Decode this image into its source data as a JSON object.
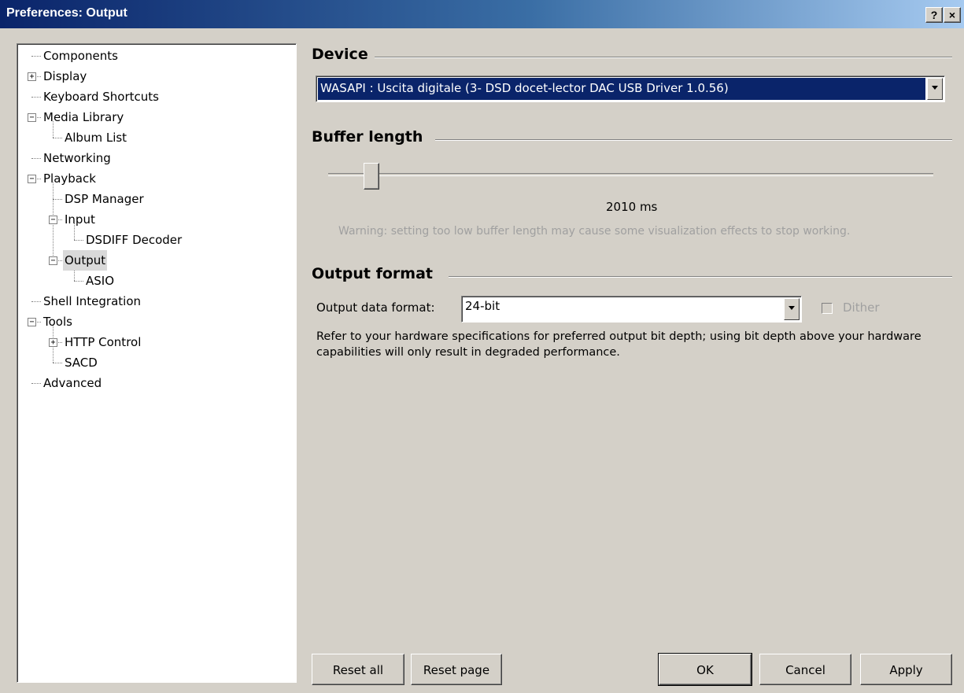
{
  "window": {
    "title": "Preferences: Output",
    "help_btn": "?",
    "close_btn": "×"
  },
  "tree": {
    "items": [
      {
        "label": "Components",
        "level": 0,
        "expander": null
      },
      {
        "label": "Display",
        "level": 0,
        "expander": "+"
      },
      {
        "label": "Keyboard Shortcuts",
        "level": 0,
        "expander": null
      },
      {
        "label": "Media Library",
        "level": 0,
        "expander": "-"
      },
      {
        "label": "Album List",
        "level": 1,
        "expander": null
      },
      {
        "label": "Networking",
        "level": 0,
        "expander": null
      },
      {
        "label": "Playback",
        "level": 0,
        "expander": "-"
      },
      {
        "label": "DSP Manager",
        "level": 1,
        "expander": null
      },
      {
        "label": "Input",
        "level": 1,
        "expander": "-"
      },
      {
        "label": "DSDIFF Decoder",
        "level": 2,
        "expander": null
      },
      {
        "label": "Output",
        "level": 1,
        "expander": "-",
        "selected": true
      },
      {
        "label": "ASIO",
        "level": 2,
        "expander": null
      },
      {
        "label": "Shell Integration",
        "level": 0,
        "expander": null
      },
      {
        "label": "Tools",
        "level": 0,
        "expander": "-"
      },
      {
        "label": "HTTP Control",
        "level": 1,
        "expander": "+"
      },
      {
        "label": "SACD",
        "level": 1,
        "expander": null
      },
      {
        "label": "Advanced",
        "level": 0,
        "expander": null
      }
    ]
  },
  "device": {
    "heading": "Device",
    "selected": "WASAPI : Uscita digitale (3- DSD docet-lector DAC USB Driver 1.0.56)"
  },
  "buffer": {
    "heading": "Buffer length",
    "value_text": "2010 ms",
    "slider_fraction": 0.07,
    "warning": "Warning: setting too low buffer length may cause some visualization effects to stop working."
  },
  "output_format": {
    "heading": "Output format",
    "label": "Output data format:",
    "selected": "24-bit",
    "dither_label": "Dither",
    "dither_checked": false,
    "note": "Refer to your hardware specifications for preferred output bit depth; using bit depth above your hardware capabilities will only result in degraded performance."
  },
  "buttons": {
    "reset_all": "Reset all",
    "reset_page": "Reset page",
    "ok": "OK",
    "cancel": "Cancel",
    "apply": "Apply"
  },
  "colors": {
    "selection": "#0a246a",
    "dialog_bg": "#d4d0c8"
  }
}
